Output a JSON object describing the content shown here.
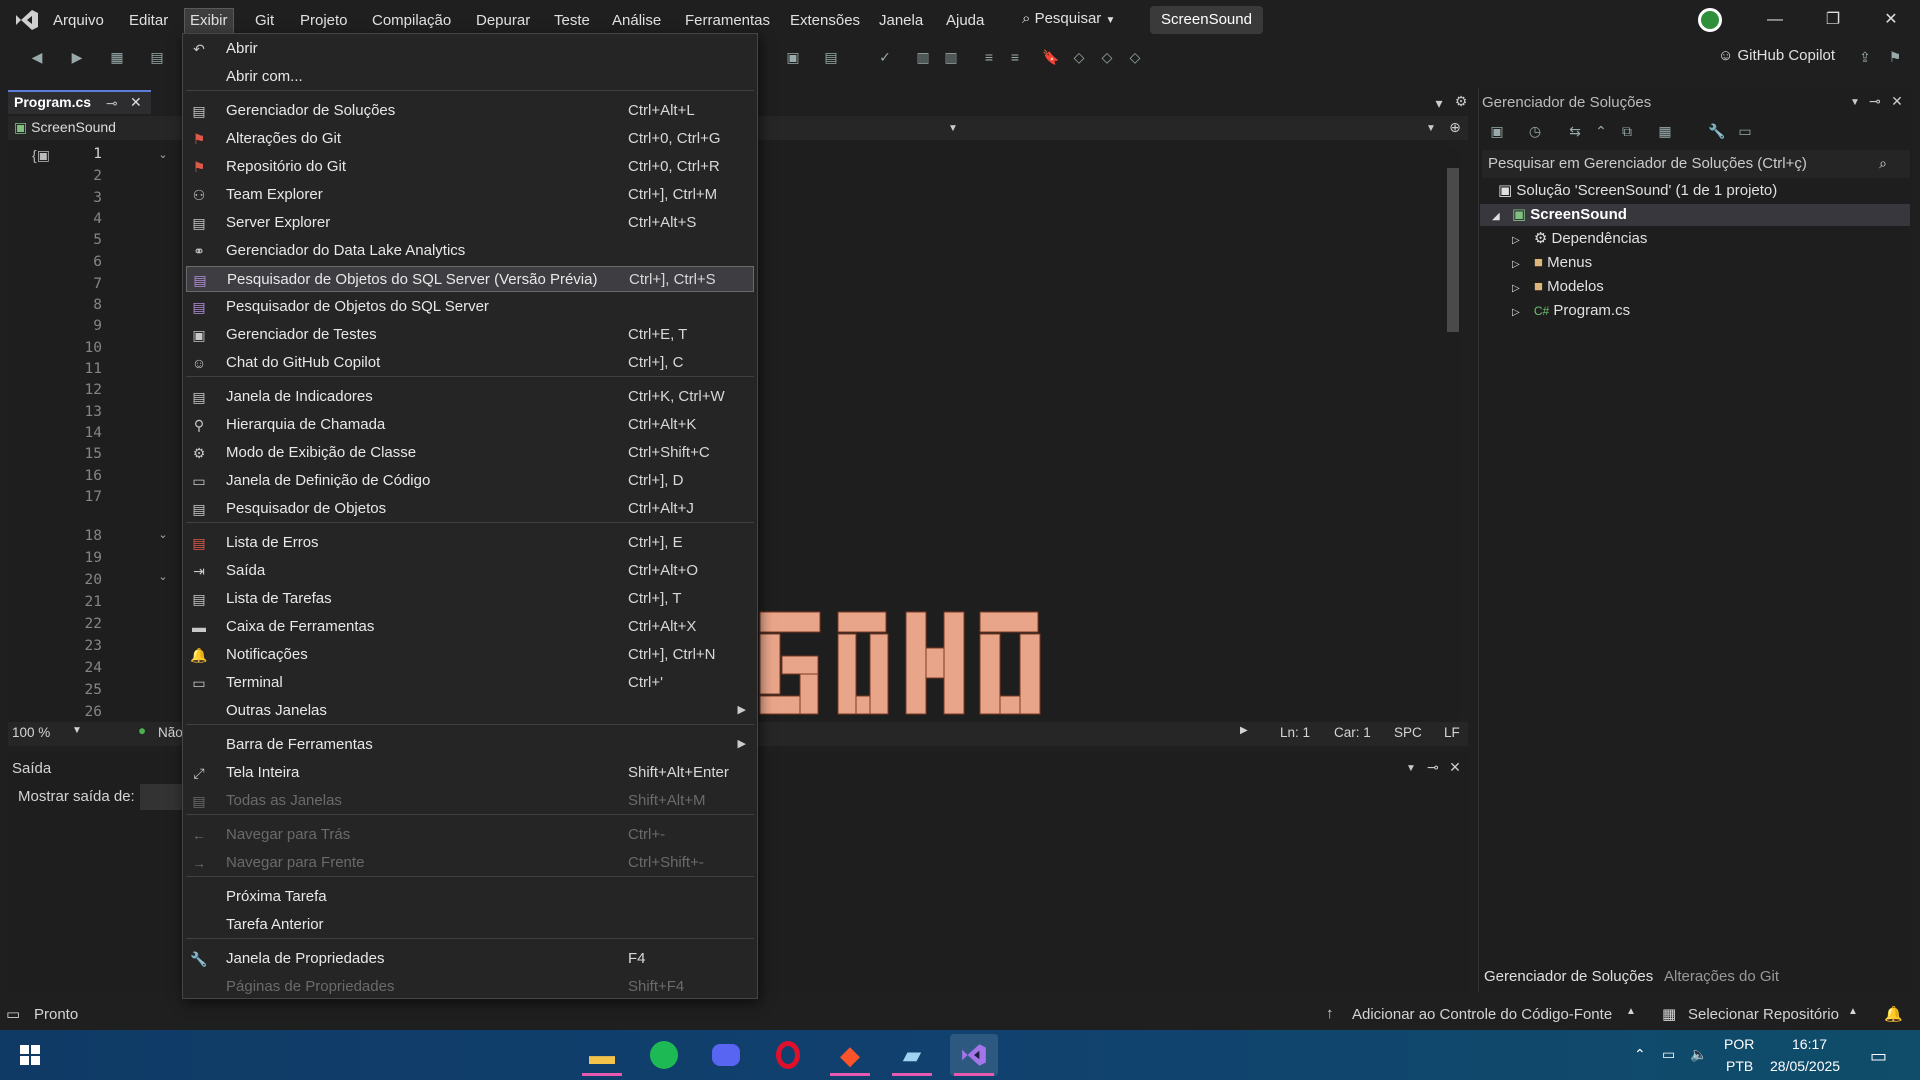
{
  "menubar": {
    "items": [
      "Arquivo",
      "Editar",
      "Exibir",
      "Git",
      "Projeto",
      "Compilação",
      "Depurar",
      "Teste",
      "Análise",
      "Ferramentas",
      "Extensões",
      "Janela",
      "Ajuda"
    ],
    "search": "Pesquisar",
    "solution_name": "ScreenSound"
  },
  "toolbar": {
    "copilot": "GitHub Copilot"
  },
  "editor": {
    "tab": "Program.cs",
    "project_nav": "ScreenSound",
    "line_numbers": [
      "1",
      "2",
      "3",
      "4",
      "5",
      "6",
      "7",
      "8",
      "9",
      "10",
      "11",
      "12",
      "13",
      "14",
      "15",
      "16",
      "17",
      "18",
      "19",
      "20",
      "21",
      "22",
      "23",
      "24",
      "25",
      "26"
    ],
    "zoom": "100 %",
    "issues": "Não",
    "ln": "Ln: 1",
    "car": "Car: 1",
    "spc": "SPC",
    "lf": "LF"
  },
  "output": {
    "title": "Saída",
    "show_label": "Mostrar saída de:"
  },
  "solution_explorer": {
    "title": "Gerenciador de Soluções",
    "search_placeholder": "Pesquisar em Gerenciador de Soluções (Ctrl+ç)",
    "solution": "Solução 'ScreenSound' (1 de 1 projeto)",
    "project": "ScreenSound",
    "nodes": [
      "Dependências",
      "Menus",
      "Modelos",
      "Program.cs"
    ],
    "tab_active": "Gerenciador de Soluções",
    "tab_other": "Alterações do Git"
  },
  "status": {
    "ready": "Pronto",
    "source_control": "Adicionar ao Controle do Código-Fonte",
    "repo": "Selecionar Repositório"
  },
  "taskbar": {
    "lang1": "POR",
    "lang2": "PTB",
    "time": "16:17",
    "date": "28/05/2025"
  },
  "view_menu": {
    "items": [
      {
        "label": "Abrir",
        "shortcut": "",
        "icon": "open-icon"
      },
      {
        "label": "Abrir com...",
        "shortcut": "",
        "icon": ""
      },
      {
        "label": "Gerenciador de Soluções",
        "shortcut": "Ctrl+Alt+L",
        "icon": "solution-explorer-icon"
      },
      {
        "label": "Alterações do Git",
        "shortcut": "Ctrl+0, Ctrl+G",
        "icon": "git-changes-icon"
      },
      {
        "label": "Repositório do Git",
        "shortcut": "Ctrl+0, Ctrl+R",
        "icon": "git-repo-icon"
      },
      {
        "label": "Team Explorer",
        "shortcut": "Ctrl+], Ctrl+M",
        "icon": "team-explorer-icon"
      },
      {
        "label": "Server Explorer",
        "shortcut": "Ctrl+Alt+S",
        "icon": "server-explorer-icon"
      },
      {
        "label": "Gerenciador do Data Lake Analytics",
        "shortcut": "",
        "icon": "data-lake-icon"
      },
      {
        "label": "Pesquisador de Objetos do SQL Server (Versão Prévia)",
        "shortcut": "Ctrl+], Ctrl+S",
        "icon": "sql-object-explorer-icon"
      },
      {
        "label": "Pesquisador de Objetos do SQL Server",
        "shortcut": "",
        "icon": "sql-object-explorer-icon"
      },
      {
        "label": "Gerenciador de Testes",
        "shortcut": "Ctrl+E, T",
        "icon": "test-explorer-icon"
      },
      {
        "label": "Chat do GitHub Copilot",
        "shortcut": "Ctrl+], C",
        "icon": "copilot-icon"
      },
      {
        "label": "Janela de Indicadores",
        "shortcut": "Ctrl+K, Ctrl+W",
        "icon": "bookmark-window-icon"
      },
      {
        "label": "Hierarquia de Chamada",
        "shortcut": "Ctrl+Alt+K",
        "icon": "call-hierarchy-icon"
      },
      {
        "label": "Modo de Exibição de Classe",
        "shortcut": "Ctrl+Shift+C",
        "icon": "class-view-icon"
      },
      {
        "label": "Janela de Definição de Código",
        "shortcut": "Ctrl+], D",
        "icon": "code-definition-icon"
      },
      {
        "label": "Pesquisador de Objetos",
        "shortcut": "Ctrl+Alt+J",
        "icon": "object-browser-icon"
      },
      {
        "label": "Lista de Erros",
        "shortcut": "Ctrl+], E",
        "icon": "error-list-icon"
      },
      {
        "label": "Saída",
        "shortcut": "Ctrl+Alt+O",
        "icon": "output-icon"
      },
      {
        "label": "Lista de Tarefas",
        "shortcut": "Ctrl+], T",
        "icon": "task-list-icon"
      },
      {
        "label": "Caixa de Ferramentas",
        "shortcut": "Ctrl+Alt+X",
        "icon": "toolbox-icon"
      },
      {
        "label": "Notificações",
        "shortcut": "Ctrl+], Ctrl+N",
        "icon": "notifications-icon"
      },
      {
        "label": "Terminal",
        "shortcut": "Ctrl+'",
        "icon": "terminal-icon"
      },
      {
        "label": "Outras Janelas",
        "shortcut": "",
        "icon": ""
      },
      {
        "label": "Barra de Ferramentas",
        "shortcut": "",
        "icon": ""
      },
      {
        "label": "Tela Inteira",
        "shortcut": "Shift+Alt+Enter",
        "icon": "fullscreen-icon"
      },
      {
        "label": "Todas as Janelas",
        "shortcut": "Shift+Alt+M",
        "icon": "all-windows-icon"
      },
      {
        "label": "Navegar para Trás",
        "shortcut": "Ctrl+-",
        "icon": "navigate-back-icon"
      },
      {
        "label": "Navegar para Frente",
        "shortcut": "Ctrl+Shift+-",
        "icon": "navigate-forward-icon"
      },
      {
        "label": "Próxima Tarefa",
        "shortcut": "",
        "icon": ""
      },
      {
        "label": "Tarefa Anterior",
        "shortcut": "",
        "icon": ""
      },
      {
        "label": "Janela de Propriedades",
        "shortcut": "F4",
        "icon": "properties-icon"
      },
      {
        "label": "Páginas de Propriedades",
        "shortcut": "Shift+F4",
        "icon": ""
      }
    ]
  }
}
